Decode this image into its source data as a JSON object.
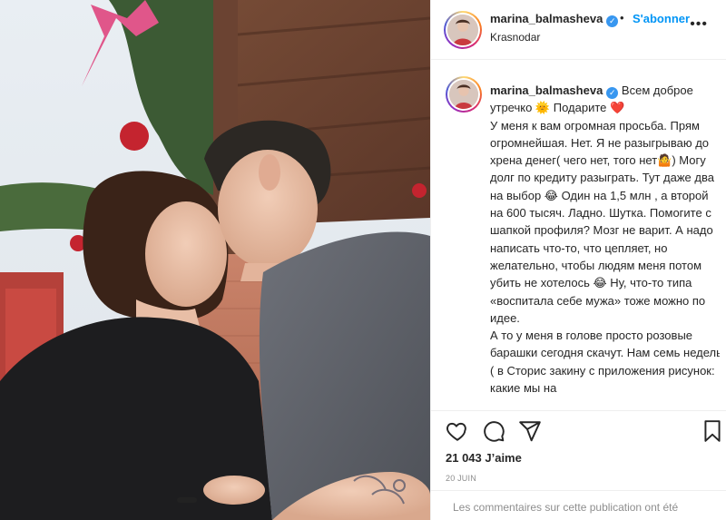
{
  "post": {
    "username": "marina_balmasheva",
    "follow_label": "S'abonner",
    "location": "Krasnodar",
    "more_label": "•••",
    "dot_separator": "•"
  },
  "caption": {
    "username": "marina_balmasheva",
    "lines": [
      "Всем доброе утречко 🌞 Подарите ❤️",
      "У меня к вам огромная просьба. Прям огромнейшая. Нет. Я не разыгрываю до хрена денег( чего нет, того нет🤷) Могу долг по кредиту разыграть. Тут даже два на выбор 😂 Один на 1,5 млн , а второй на 600 тысяч. Ладно. Шутка. Помогите с шапкой профиля? Мозг не варит. А надо написать что-то, что цепляет, но желательно, чтобы людям меня потом убить не хотелось 😂 Ну, что-то типа «воспитала себе мужа» тоже можно по идее.",
      "А то у меня в голове просто розовые барашки сегодня скачут. Нам семь недель ( в Сторис закину с приложения рисунок: какие мы на"
    ]
  },
  "engagement": {
    "likes": "21 043 J’aime",
    "date": "20 JUIN"
  },
  "footer": {
    "comments_notice": "Les commentaires sur cette publication ont été"
  },
  "icons": {
    "like": "heart-icon",
    "comment": "comment-icon",
    "share": "share-icon",
    "save": "bookmark-icon",
    "verified": "verified-badge-icon"
  },
  "colors": {
    "follow": "#0095f6",
    "verified": "#3897f0",
    "muted": "#8e8e8e"
  }
}
